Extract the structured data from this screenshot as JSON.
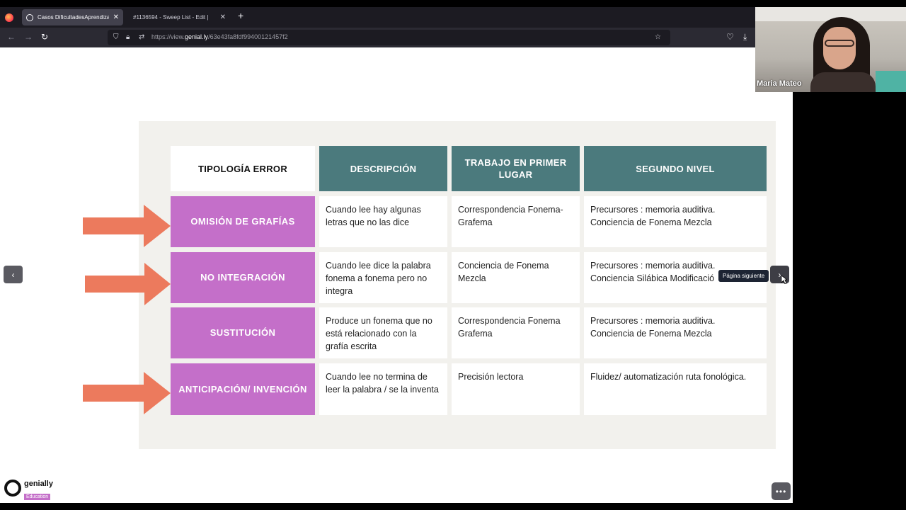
{
  "browser": {
    "tabs": [
      {
        "label": "Casos DificultadesAprendizajeLe"
      },
      {
        "label": "#1136594 - Sweep List - Edit |"
      }
    ],
    "url_prefix": "https://view.",
    "url_domain": "genial.ly",
    "url_path": "/63e43fa8fdf99400121457f2"
  },
  "table": {
    "headers": [
      "TIPOLOGÍA ERROR",
      "DESCRIPCIÓN",
      "TRABAJO EN PRIMER LUGAR",
      "SEGUNDO NIVEL"
    ],
    "rows": [
      {
        "type": "OMISIÓN DE GRAFÍAS",
        "description": "Cuando lee hay algunas letras que no las dice",
        "first": "Correspondencia Fonema-Grafema",
        "second": "Precursores : memoria auditiva. Conciencia de Fonema Mezcla"
      },
      {
        "type": "NO INTEGRACIÓN",
        "description": "Cuando lee dice la palabra fonema a fonema pero no integra",
        "first": "Conciencia de Fonema Mezcla",
        "second": "Precursores : memoria auditiva. Conciencia Silábica Modificació"
      },
      {
        "type": "SUSTITUCIÓN",
        "description": "Produce un fonema que no está relacionado con la grafía escrita",
        "first": "Correspondencia Fonema Grafema",
        "second": "Precursores : memoria auditiva. Conciencia de Fonema Mezcla"
      },
      {
        "type": "ANTICIPACIÓN/ INVENCIÓN",
        "description": "Cuando lee no termina de leer la palabra / se la inventa",
        "first": "Precisión lectora",
        "second": "Fluidez/ automatización ruta fonológica."
      }
    ]
  },
  "nav": {
    "prev": "‹",
    "next": "›",
    "tooltip": "Página siguiente"
  },
  "branding": {
    "name": "genially",
    "edition": "Education"
  },
  "video": {
    "participant": "Maria Mateo"
  },
  "colors": {
    "header": "#4b7a7d",
    "type_cell": "#c46fc9",
    "arrow": "#ec7a5d",
    "slide_bg": "#f2f1ed"
  }
}
